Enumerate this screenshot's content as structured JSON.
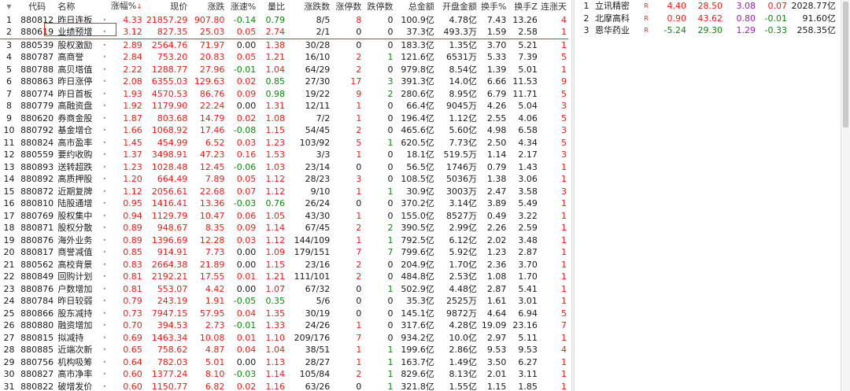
{
  "main_table": {
    "headers": {
      "idx": "",
      "code": "代码",
      "name": "名称",
      "dot": "",
      "pct": "涨幅%",
      "sort_mark": "↓",
      "price": "现价",
      "change": "涨跌",
      "speed": "涨速%",
      "vol_ratio": "量比",
      "up_down": "涨跌数",
      "limit_up": "涨停数",
      "limit_down": "跌停数",
      "amount": "总金额",
      "open_amount": "开盘金额",
      "turnover": "换手%",
      "turnover_z": "换手Z",
      "streak": "连涨天"
    },
    "rows": [
      {
        "i": "1",
        "code": "880812",
        "name": "昨日连板",
        "pct": "4.33",
        "price": "21857.29",
        "chg": "907.80",
        "spd": "-0.14",
        "vr": "0.79",
        "ud": "8/5",
        "lu": "8",
        "ld": "0",
        "amt": "100.9亿",
        "oa": "4.78亿",
        "to": "7.43",
        "tz": "13.26",
        "st": "4"
      },
      {
        "i": "2",
        "code": "880619",
        "name": "业绩预增",
        "pct": "3.12",
        "price": "827.35",
        "chg": "25.03",
        "spd": "0.05",
        "vr": "2.74",
        "ud": "2/1",
        "lu": "0",
        "ld": "0",
        "amt": "37.3亿",
        "oa": "493.3万",
        "to": "1.59",
        "tz": "2.58",
        "st": "1"
      },
      {
        "i": "3",
        "code": "880539",
        "name": "股权激励",
        "pct": "2.89",
        "price": "2564.76",
        "chg": "71.97",
        "spd": "0.00",
        "vr": "1.38",
        "ud": "30/28",
        "lu": "0",
        "ld": "0",
        "amt": "183.3亿",
        "oa": "1.35亿",
        "to": "3.70",
        "tz": "5.21",
        "st": "1"
      },
      {
        "i": "4",
        "code": "880787",
        "name": "高商誉",
        "pct": "2.84",
        "price": "753.20",
        "chg": "20.83",
        "spd": "0.05",
        "vr": "1.21",
        "ud": "16/10",
        "lu": "2",
        "ld": "1",
        "amt": "121.6亿",
        "oa": "6531万",
        "to": "5.33",
        "tz": "7.39",
        "st": "5"
      },
      {
        "i": "5",
        "code": "880788",
        "name": "高贝塔值",
        "pct": "2.22",
        "price": "1288.77",
        "chg": "27.96",
        "spd": "-0.01",
        "vr": "1.04",
        "ud": "64/29",
        "lu": "2",
        "ld": "0",
        "amt": "979.8亿",
        "oa": "8.54亿",
        "to": "1.39",
        "tz": "5.01",
        "st": "1"
      },
      {
        "i": "6",
        "code": "880863",
        "name": "昨日涨停",
        "pct": "2.08",
        "price": "6355.03",
        "chg": "129.63",
        "spd": "0.02",
        "vr": "0.85",
        "ud": "27/30",
        "lu": "17",
        "ld": "3",
        "amt": "391.3亿",
        "oa": "14.0亿",
        "to": "6.66",
        "tz": "11.53",
        "st": "9"
      },
      {
        "i": "7",
        "code": "880774",
        "name": "昨日首板",
        "pct": "1.93",
        "price": "4570.53",
        "chg": "86.76",
        "spd": "0.09",
        "vr": "0.98",
        "ud": "19/22",
        "lu": "9",
        "ld": "2",
        "amt": "280.6亿",
        "oa": "8.95亿",
        "to": "6.79",
        "tz": "11.71",
        "st": "5"
      },
      {
        "i": "8",
        "code": "880779",
        "name": "高融资盘",
        "pct": "1.92",
        "price": "1179.90",
        "chg": "22.24",
        "spd": "0.00",
        "vr": "1.31",
        "ud": "12/11",
        "lu": "1",
        "ld": "0",
        "amt": "66.4亿",
        "oa": "9045万",
        "to": "4.26",
        "tz": "5.04",
        "st": "3"
      },
      {
        "i": "9",
        "code": "880620",
        "name": "券商金股",
        "pct": "1.87",
        "price": "803.68",
        "chg": "14.79",
        "spd": "0.02",
        "vr": "1.08",
        "ud": "7/2",
        "lu": "1",
        "ld": "0",
        "amt": "196.4亿",
        "oa": "1.12亿",
        "to": "2.55",
        "tz": "4.06",
        "st": "5"
      },
      {
        "i": "10",
        "code": "880792",
        "name": "基金增仓",
        "pct": "1.66",
        "price": "1068.92",
        "chg": "17.46",
        "spd": "-0.08",
        "vr": "1.15",
        "ud": "54/45",
        "lu": "2",
        "ld": "0",
        "amt": "465.6亿",
        "oa": "5.60亿",
        "to": "4.98",
        "tz": "6.58",
        "st": "3"
      },
      {
        "i": "11",
        "code": "880824",
        "name": "高市盈率",
        "pct": "1.45",
        "price": "454.99",
        "chg": "6.52",
        "spd": "0.03",
        "vr": "1.23",
        "ud": "103/92",
        "lu": "5",
        "ld": "1",
        "amt": "620.5亿",
        "oa": "7.73亿",
        "to": "2.50",
        "tz": "4.34",
        "st": "5"
      },
      {
        "i": "12",
        "code": "880559",
        "name": "要约收购",
        "pct": "1.37",
        "price": "3498.91",
        "chg": "47.23",
        "spd": "0.16",
        "vr": "1.53",
        "ud": "3/3",
        "lu": "1",
        "ld": "0",
        "amt": "18.1亿",
        "oa": "519.5万",
        "to": "1.14",
        "tz": "2.17",
        "st": "3"
      },
      {
        "i": "13",
        "code": "880893",
        "name": "送转超跌",
        "pct": "1.23",
        "price": "1028.48",
        "chg": "12.45",
        "spd": "-0.06",
        "vr": "1.03",
        "ud": "23/14",
        "lu": "0",
        "ld": "0",
        "amt": "56.5亿",
        "oa": "1746万",
        "to": "0.79",
        "tz": "1.43",
        "st": "1"
      },
      {
        "i": "14",
        "code": "880892",
        "name": "高质押股",
        "pct": "1.20",
        "price": "664.49",
        "chg": "7.89",
        "spd": "0.05",
        "vr": "1.12",
        "ud": "28/23",
        "lu": "3",
        "ld": "0",
        "amt": "108.5亿",
        "oa": "5036万",
        "to": "1.38",
        "tz": "3.06",
        "st": "1"
      },
      {
        "i": "15",
        "code": "880872",
        "name": "近期复牌",
        "pct": "1.12",
        "price": "2056.61",
        "chg": "22.68",
        "spd": "0.07",
        "vr": "1.12",
        "ud": "9/10",
        "lu": "1",
        "ld": "1",
        "amt": "30.9亿",
        "oa": "3003万",
        "to": "2.47",
        "tz": "3.58",
        "st": "3"
      },
      {
        "i": "16",
        "code": "880810",
        "name": "陆股通增",
        "pct": "0.95",
        "price": "1416.41",
        "chg": "13.36",
        "spd": "-0.03",
        "vr": "0.76",
        "ud": "26/24",
        "lu": "0",
        "ld": "0",
        "amt": "370.2亿",
        "oa": "3.14亿",
        "to": "3.89",
        "tz": "5.49",
        "st": "1"
      },
      {
        "i": "17",
        "code": "880769",
        "name": "股权集中",
        "pct": "0.94",
        "price": "1129.79",
        "chg": "10.47",
        "spd": "0.06",
        "vr": "1.05",
        "ud": "43/30",
        "lu": "1",
        "ld": "0",
        "amt": "155.0亿",
        "oa": "8527万",
        "to": "0.49",
        "tz": "3.22",
        "st": "1"
      },
      {
        "i": "18",
        "code": "880871",
        "name": "股权分散",
        "pct": "0.89",
        "price": "948.67",
        "chg": "8.35",
        "spd": "0.09",
        "vr": "1.14",
        "ud": "67/45",
        "lu": "2",
        "ld": "2",
        "amt": "390.5亿",
        "oa": "2.99亿",
        "to": "2.26",
        "tz": "2.59",
        "st": "1"
      },
      {
        "i": "19",
        "code": "880876",
        "name": "海外业务",
        "pct": "0.89",
        "price": "1396.69",
        "chg": "12.28",
        "spd": "0.03",
        "vr": "1.12",
        "ud": "144/109",
        "lu": "1",
        "ld": "1",
        "amt": "792.5亿",
        "oa": "6.12亿",
        "to": "2.02",
        "tz": "3.48",
        "st": "1"
      },
      {
        "i": "20",
        "code": "880817",
        "name": "商誉减值",
        "pct": "0.85",
        "price": "914.91",
        "chg": "7.73",
        "spd": "0.00",
        "vr": "1.09",
        "ud": "179/151",
        "lu": "7",
        "ld": "7",
        "amt": "799.6亿",
        "oa": "5.92亿",
        "to": "1.23",
        "tz": "2.87",
        "st": "1"
      },
      {
        "i": "21",
        "code": "880562",
        "name": "高校背景",
        "pct": "0.83",
        "price": "2664.38",
        "chg": "21.89",
        "spd": "0.00",
        "vr": "1.15",
        "ud": "23/16",
        "lu": "2",
        "ld": "0",
        "amt": "204.9亿",
        "oa": "1.70亿",
        "to": "2.36",
        "tz": "3.70",
        "st": "1"
      },
      {
        "i": "22",
        "code": "880849",
        "name": "回购计划",
        "pct": "0.81",
        "price": "2192.21",
        "chg": "17.55",
        "spd": "0.01",
        "vr": "1.21",
        "ud": "111/101",
        "lu": "2",
        "ld": "0",
        "amt": "484.8亿",
        "oa": "2.53亿",
        "to": "1.08",
        "tz": "1.70",
        "st": "1"
      },
      {
        "i": "23",
        "code": "880876",
        "name": "户数增加",
        "pct": "0.81",
        "price": "553.07",
        "chg": "4.42",
        "spd": "0.00",
        "vr": "1.07",
        "ud": "67/32",
        "lu": "0",
        "ld": "1",
        "amt": "502.9亿",
        "oa": "4.48亿",
        "to": "2.87",
        "tz": "5.41",
        "st": "1"
      },
      {
        "i": "24",
        "code": "880784",
        "name": "昨日较弱",
        "pct": "0.79",
        "price": "243.19",
        "chg": "1.91",
        "spd": "-0.05",
        "vr": "0.35",
        "ud": "5/6",
        "lu": "0",
        "ld": "0",
        "amt": "35.3亿",
        "oa": "2525万",
        "to": "1.61",
        "tz": "3.01",
        "st": "1"
      },
      {
        "i": "25",
        "code": "880866",
        "name": "股东减持",
        "pct": "0.73",
        "price": "7947.15",
        "chg": "57.95",
        "spd": "0.04",
        "vr": "1.35",
        "ud": "30/19",
        "lu": "0",
        "ld": "0",
        "amt": "145.1亿",
        "oa": "9872万",
        "to": "4.64",
        "tz": "6.94",
        "st": "5"
      },
      {
        "i": "26",
        "code": "880880",
        "name": "融资增加",
        "pct": "0.70",
        "price": "394.53",
        "chg": "2.73",
        "spd": "-0.01",
        "vr": "1.33",
        "ud": "24/26",
        "lu": "1",
        "ld": "0",
        "amt": "317.6亿",
        "oa": "4.28亿",
        "to": "19.09",
        "tz": "23.16",
        "st": "7"
      },
      {
        "i": "27",
        "code": "880815",
        "name": "拟减持",
        "pct": "0.69",
        "price": "1463.34",
        "chg": "10.08",
        "spd": "0.01",
        "vr": "1.10",
        "ud": "209/176",
        "lu": "7",
        "ld": "0",
        "amt": "934.2亿",
        "oa": "10.0亿",
        "to": "2.97",
        "tz": "5.11",
        "st": "1"
      },
      {
        "i": "28",
        "code": "880885",
        "name": "近端次新",
        "pct": "0.65",
        "price": "758.62",
        "chg": "4.87",
        "spd": "0.04",
        "vr": "1.04",
        "ud": "38/51",
        "lu": "1",
        "ld": "1",
        "amt": "199.6亿",
        "oa": "2.86亿",
        "to": "9.53",
        "tz": "9.53",
        "st": "4"
      },
      {
        "i": "29",
        "code": "880756",
        "name": "机构吸筹",
        "pct": "0.64",
        "price": "782.03",
        "chg": "5.01",
        "spd": "0.00",
        "vr": "1.13",
        "ud": "28/27",
        "lu": "1",
        "ld": "1",
        "amt": "163.7亿",
        "oa": "1.49亿",
        "to": "3.50",
        "tz": "6.27",
        "st": "1"
      },
      {
        "i": "30",
        "code": "880827",
        "name": "高市净率",
        "pct": "0.60",
        "price": "1377.24",
        "chg": "8.10",
        "spd": "-0.03",
        "vr": "1.14",
        "ud": "105/84",
        "lu": "2",
        "ld": "1",
        "amt": "829.6亿",
        "oa": "8.13亿",
        "to": "2.01",
        "tz": "3.11",
        "st": "1"
      },
      {
        "i": "31",
        "code": "880822",
        "name": "破增发价",
        "pct": "0.60",
        "price": "1150.77",
        "chg": "6.82",
        "spd": "0.02",
        "vr": "1.16",
        "ud": "63/26",
        "lu": "0",
        "ld": "1",
        "amt": "321.8亿",
        "oa": "1.55亿",
        "to": "1.15",
        "tz": "1.85",
        "st": "1"
      }
    ]
  },
  "side_table": {
    "rows": [
      {
        "i": "1",
        "name": "立讯精密",
        "flag": "R",
        "pct": "4.40",
        "price": "28.50",
        "chg": "3.08",
        "spd": "0.07",
        "amt": "2028.77亿"
      },
      {
        "i": "2",
        "name": "北摩高科",
        "flag": "R",
        "pct": "0.90",
        "price": "43.62",
        "chg": "0.80",
        "spd": "-0.01",
        "amt": "91.60亿"
      },
      {
        "i": "3",
        "name": "恩华药业",
        "flag": "R",
        "pct": "-5.24",
        "price": "29.30",
        "chg": "1.29",
        "spd": "-0.33",
        "amt": "258.35亿"
      }
    ]
  },
  "colors": {
    "up": "#e8221a",
    "down": "#0a8a0a",
    "highlight_box": "#e2312a",
    "selection_line": "#2d6fd6"
  }
}
